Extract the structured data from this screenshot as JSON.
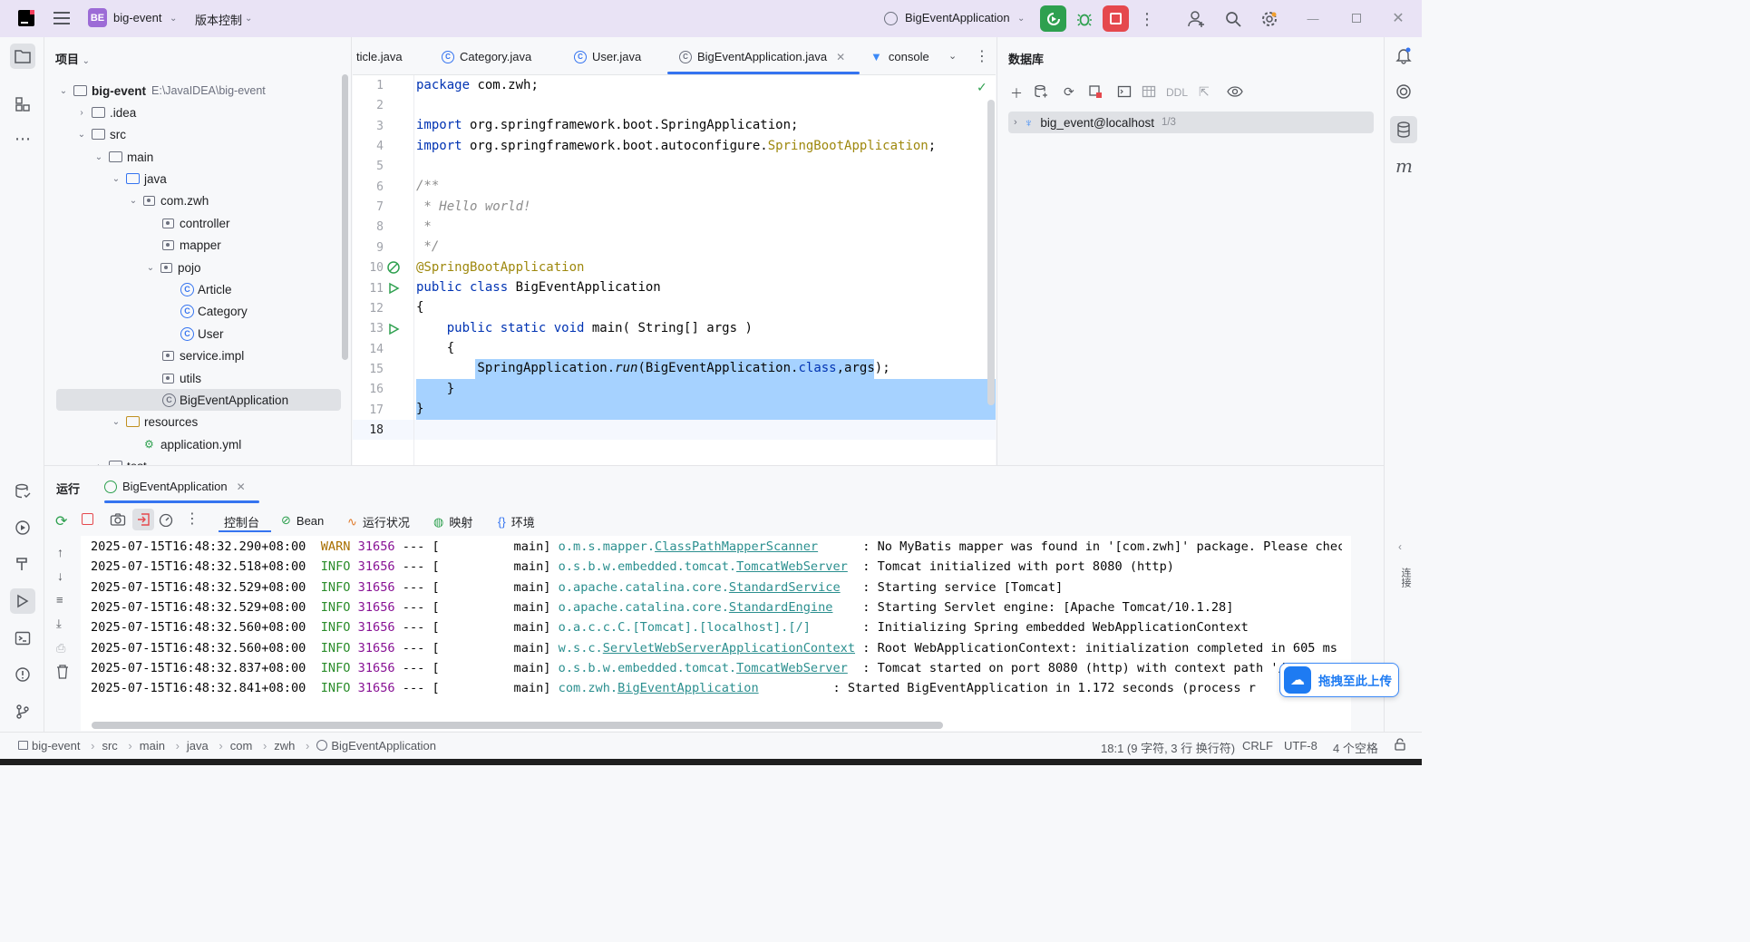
{
  "titlebar": {
    "project_badge": "BE",
    "project_name": "big-event",
    "vcs": "版本控制",
    "run_config": "BigEventApplication"
  },
  "project_panel": {
    "title": "项目",
    "tree": [
      {
        "label": "big-event",
        "path": "E:\\JavaIDEA\\big-event"
      },
      {
        "label": ".idea"
      },
      {
        "label": "src"
      },
      {
        "label": "main"
      },
      {
        "label": "java"
      },
      {
        "label": "com.zwh"
      },
      {
        "label": "controller"
      },
      {
        "label": "mapper"
      },
      {
        "label": "pojo"
      },
      {
        "label": "Article"
      },
      {
        "label": "Category"
      },
      {
        "label": "User"
      },
      {
        "label": "service.impl"
      },
      {
        "label": "utils"
      },
      {
        "label": "BigEventApplication"
      },
      {
        "label": "resources"
      },
      {
        "label": "application.yml"
      },
      {
        "label": "test"
      }
    ]
  },
  "tabs": [
    {
      "label": "ticle.java"
    },
    {
      "label": "Category.java"
    },
    {
      "label": "User.java"
    },
    {
      "label": "BigEventApplication.java"
    },
    {
      "label": "console"
    }
  ],
  "editor": {
    "line_numbers": [
      "1",
      "2",
      "3",
      "4",
      "5",
      "6",
      "7",
      "8",
      "9",
      "10",
      "11",
      "12",
      "13",
      "14",
      "15",
      "16",
      "17",
      "18"
    ],
    "code": {
      "l1_kw": "package",
      "l1_rest": " com.zwh;",
      "l3_kw": "import",
      "l3_rest": " org.springframework.boot.SpringApplication;",
      "l4_kw": "import",
      "l4_rest": " org.springframework.boot.autoconfigure.",
      "l4_ann": "SpringBootApplication",
      "l4_end": ";",
      "l6": "/**",
      "l7": " * Hello world!",
      "l8": " *",
      "l9": " */",
      "l10": "@SpringBootApplication",
      "l11_kw": "public class",
      "l11_rest": " BigEventApplication",
      "l12": "{",
      "l13_indent": "    ",
      "l13_kw": "public static void",
      "l13_rest": " main( String[] args )",
      "l14": "    {",
      "l15_a": "        SpringApplication.",
      "l15_run": "run",
      "l15_b": "(BigEventApplication.",
      "l15_kw": "class",
      "l15_c": ",args);",
      "l16": "    }",
      "l17": "}"
    }
  },
  "database": {
    "title": "数据库",
    "ddl": "DDL",
    "connection": "big_event@localhost",
    "count": "1/3"
  },
  "run_panel": {
    "title": "运行",
    "config_tab": "BigEventApplication",
    "subtabs": [
      "控制台",
      "Bean",
      "运行状况",
      "映射",
      "环境"
    ],
    "logs": [
      {
        "ts": "2025-07-15T16:48:32.290+08:00",
        "level": "WARN",
        "pid": "31656",
        "sep": " --- [          main] ",
        "logger_pre": "o.m.s.mapper.",
        "logger_link": "ClassPathMapperScanner",
        "pad": "      ",
        "msg": ": No MyBatis mapper was found in '[com.zwh]' package. Please check"
      },
      {
        "ts": "2025-07-15T16:48:32.518+08:00",
        "level": "INFO",
        "pid": "31656",
        "sep": " --- [          main] ",
        "logger_pre": "o.s.b.w.embedded.tomcat.",
        "logger_link": "TomcatWebServer",
        "pad": "  ",
        "msg": ": Tomcat initialized with port 8080 (http)"
      },
      {
        "ts": "2025-07-15T16:48:32.529+08:00",
        "level": "INFO",
        "pid": "31656",
        "sep": " --- [          main] ",
        "logger_pre": "o.apache.catalina.core.",
        "logger_link": "StandardService",
        "pad": "   ",
        "msg": ": Starting service [Tomcat]"
      },
      {
        "ts": "2025-07-15T16:48:32.529+08:00",
        "level": "INFO",
        "pid": "31656",
        "sep": " --- [          main] ",
        "logger_pre": "o.apache.catalina.core.",
        "logger_link": "StandardEngine",
        "pad": "    ",
        "msg": ": Starting Servlet engine: [Apache Tomcat/10.1.28]"
      },
      {
        "ts": "2025-07-15T16:48:32.560+08:00",
        "level": "INFO",
        "pid": "31656",
        "sep": " --- [          main] ",
        "logger_pre": "o.a.c.c.C.[Tomcat].[localhost].[/]",
        "logger_link": "",
        "pad": "       ",
        "msg": ": Initializing Spring embedded WebApplicationContext"
      },
      {
        "ts": "2025-07-15T16:48:32.560+08:00",
        "level": "INFO",
        "pid": "31656",
        "sep": " --- [          main] ",
        "logger_pre": "w.s.c.",
        "logger_link": "ServletWebServerApplicationContext",
        "pad": " ",
        "msg": ": Root WebApplicationContext: initialization completed in 605 ms"
      },
      {
        "ts": "2025-07-15T16:48:32.837+08:00",
        "level": "INFO",
        "pid": "31656",
        "sep": " --- [          main] ",
        "logger_pre": "o.s.b.w.embedded.tomcat.",
        "logger_link": "TomcatWebServer",
        "pad": "  ",
        "msg": ": Tomcat started on port 8080 (http) with context path '/"
      },
      {
        "ts": "2025-07-15T16:48:32.841+08:00",
        "level": "INFO",
        "pid": "31656",
        "sep": " --- [          main] ",
        "logger_pre": "com.zwh.",
        "logger_link": "BigEventApplication",
        "pad": "          ",
        "msg": ": Started BigEventApplication in 1.172 seconds (process r"
      }
    ]
  },
  "upload_badge": "拖拽至此上传",
  "right_vertical": "连接",
  "statusbar": {
    "breadcrumbs": [
      "big-event",
      "src",
      "main",
      "java",
      "com",
      "zwh",
      "BigEventApplication"
    ],
    "position": "18:1 (9 字符, 3 行 换行符)",
    "line_sep": "CRLF",
    "encoding": "UTF-8",
    "indent": "4 个空格"
  },
  "colors": {
    "accent": "#3574f0",
    "run": "#2ea04f",
    "stop": "#e5484d",
    "titlebar": "#e9e3f5",
    "selection": "#a6d2ff"
  }
}
